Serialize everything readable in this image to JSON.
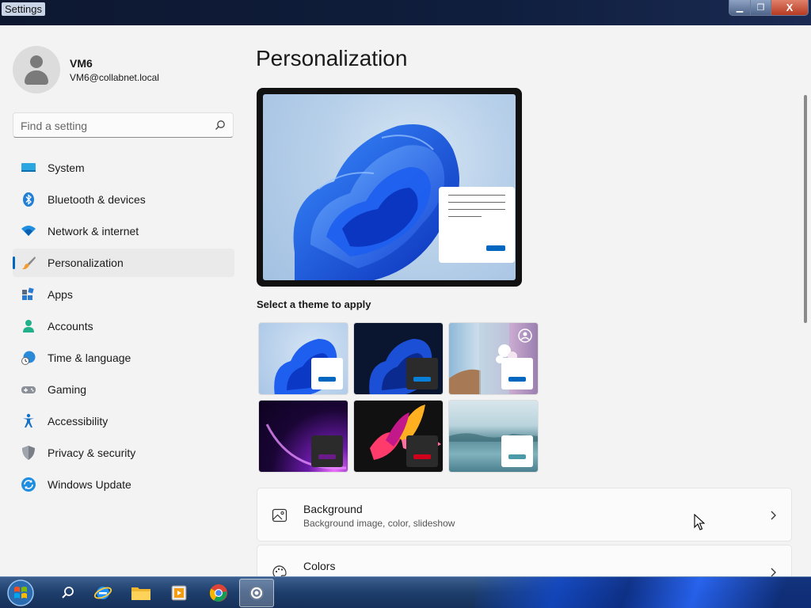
{
  "window": {
    "title": "Settings",
    "min_glyph": "▁",
    "max_glyph": "❐",
    "close_glyph": "X"
  },
  "user": {
    "name": "VM6",
    "email": "VM6@collabnet.local"
  },
  "search": {
    "placeholder": "Find a setting",
    "icon": "search-icon"
  },
  "nav": {
    "items": [
      {
        "label": "System",
        "icon": "monitor-icon"
      },
      {
        "label": "Bluetooth & devices",
        "icon": "bluetooth-icon"
      },
      {
        "label": "Network & internet",
        "icon": "wifi-icon"
      },
      {
        "label": "Personalization",
        "icon": "brush-icon",
        "active": true
      },
      {
        "label": "Apps",
        "icon": "apps-icon"
      },
      {
        "label": "Accounts",
        "icon": "person-icon"
      },
      {
        "label": "Time & language",
        "icon": "globe-clock-icon"
      },
      {
        "label": "Gaming",
        "icon": "gamepad-icon"
      },
      {
        "label": "Accessibility",
        "icon": "accessibility-icon"
      },
      {
        "label": "Privacy & security",
        "icon": "shield-icon"
      },
      {
        "label": "Windows Update",
        "icon": "update-icon"
      }
    ]
  },
  "main": {
    "title": "Personalization",
    "theme_label": "Select a theme to apply",
    "themes": [
      {
        "name": "windows-light",
        "accent": "#0067c0"
      },
      {
        "name": "windows-dark",
        "accent": "#0067c0"
      },
      {
        "name": "spotlight",
        "accent": "#0067c0"
      },
      {
        "name": "glow",
        "accent": "#6b1a8a"
      },
      {
        "name": "captured-motion",
        "accent": "#d0021b"
      },
      {
        "name": "flow",
        "accent": "#4a9aa8"
      }
    ],
    "cards": [
      {
        "title": "Background",
        "subtitle": "Background image, color, slideshow",
        "icon": "image-icon"
      },
      {
        "title": "Colors",
        "subtitle": "",
        "icon": "palette-icon"
      }
    ]
  },
  "colors": {
    "accent": "#0067c0",
    "window_bg": "#f3f3f3"
  }
}
